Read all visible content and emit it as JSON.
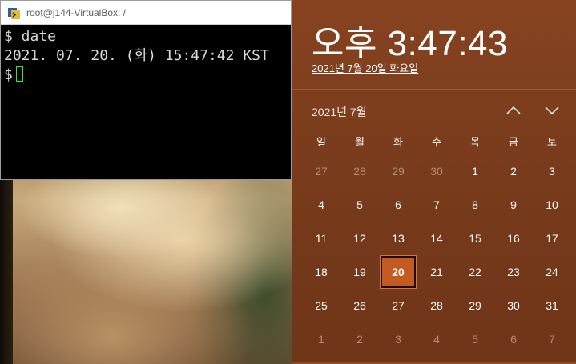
{
  "terminal": {
    "title": "root@j144-VirtualBox: /",
    "lines": [
      "$ date",
      "2021. 07. 20. (화) 15:47:42 KST",
      "$"
    ]
  },
  "clock": {
    "time": "오후 3:47:43",
    "date_long": "2021년 7월 20일 화요일"
  },
  "calendar": {
    "month_label": "2021년 7월",
    "weekdays": [
      "일",
      "월",
      "화",
      "수",
      "목",
      "금",
      "토"
    ],
    "weeks": [
      [
        "27",
        "28",
        "29",
        "30",
        "1",
        "2",
        "3"
      ],
      [
        "4",
        "5",
        "6",
        "7",
        "8",
        "9",
        "10"
      ],
      [
        "11",
        "12",
        "13",
        "14",
        "15",
        "16",
        "17"
      ],
      [
        "18",
        "19",
        "20",
        "21",
        "22",
        "23",
        "24"
      ],
      [
        "25",
        "26",
        "27",
        "28",
        "29",
        "30",
        "31"
      ],
      [
        "1",
        "2",
        "3",
        "4",
        "5",
        "6",
        "7"
      ]
    ],
    "today": "20",
    "colors": {
      "accent": "#c35a20",
      "background": "#7a3c1c",
      "muted_text": "#b88a70"
    }
  },
  "icons": {
    "terminal_icon": "terminal-app-icon",
    "prev_month": "chevron-up-icon",
    "next_month": "chevron-down-icon"
  }
}
